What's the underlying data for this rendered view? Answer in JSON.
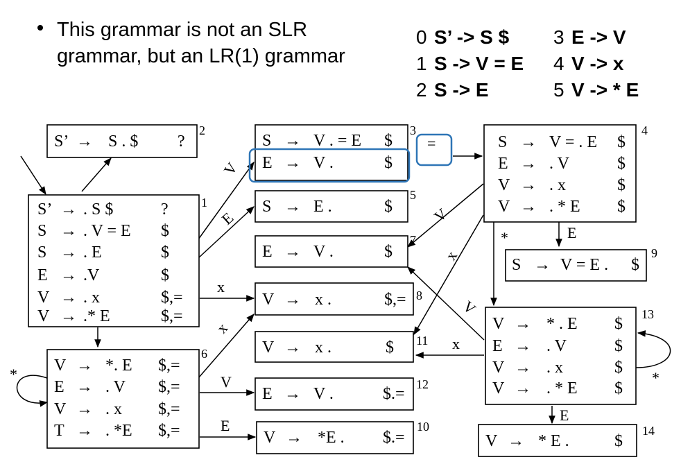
{
  "bullet": {
    "line1": "This grammar is not an SLR",
    "line2": "grammar, but an LR(1) grammar"
  },
  "rules": [
    {
      "num": "0",
      "text": "S’ -> S $"
    },
    {
      "num": "3",
      "text": "E -> V"
    },
    {
      "num": "1",
      "text": "S -> V = E"
    },
    {
      "num": "4",
      "text": "V -> x"
    },
    {
      "num": "2",
      "text": "S -> E"
    },
    {
      "num": "5",
      "text": "V -> * E"
    }
  ],
  "states": {
    "s1": {
      "num": "1",
      "items": [
        {
          "lhs": "S’",
          "rhs": ". S $",
          "la": "?"
        },
        {
          "lhs": "S",
          "rhs": ". V = E",
          "la": "$"
        },
        {
          "lhs": "S",
          "rhs": ". E",
          "la": "$"
        },
        {
          "lhs": "E",
          "rhs": ".V",
          "la": "$"
        },
        {
          "lhs": "V",
          "rhs": ". x",
          "la": "$,="
        },
        {
          "lhs": "V",
          "rhs": ".* E",
          "la": "$,="
        }
      ]
    },
    "s2": {
      "num": "2",
      "items": [
        {
          "lhs": "S’",
          "rhs": "S . $",
          "la": "?"
        }
      ]
    },
    "s3": {
      "num": "3",
      "items": [
        {
          "lhs": "S",
          "rhs": "V . = E",
          "la": "$"
        },
        {
          "lhs": "E",
          "rhs": "V .",
          "la": "$"
        }
      ]
    },
    "s4": {
      "num": "4",
      "items": [
        {
          "lhs": "S",
          "rhs": "V = . E",
          "la": "$"
        },
        {
          "lhs": "E",
          "rhs": ". V",
          "la": "$"
        },
        {
          "lhs": "V",
          "rhs": ". x",
          "la": "$"
        },
        {
          "lhs": "V",
          "rhs": ". * E",
          "la": "$"
        }
      ]
    },
    "s5": {
      "num": "5",
      "items": [
        {
          "lhs": "S",
          "rhs": "E .",
          "la": "$"
        }
      ]
    },
    "s6": {
      "num": "6",
      "items": [
        {
          "lhs": "V",
          "rhs": "*. E",
          "la": "$,="
        },
        {
          "lhs": "E",
          "rhs": ". V",
          "la": "$,="
        },
        {
          "lhs": "V",
          "rhs": ". x",
          "la": "$,="
        },
        {
          "lhs": "T",
          "rhs": ". *E",
          "la": "$,="
        }
      ]
    },
    "s7": {
      "num": "7",
      "items": [
        {
          "lhs": "E",
          "rhs": "V .",
          "la": "$"
        }
      ]
    },
    "s8": {
      "num": "8",
      "items": [
        {
          "lhs": "V",
          "rhs": "x .",
          "la": "$,="
        }
      ]
    },
    "s9": {
      "num": "9",
      "items": [
        {
          "lhs": "S",
          "rhs": "V = E .",
          "la": "$"
        }
      ]
    },
    "s10": {
      "num": "10",
      "items": [
        {
          "lhs": "V",
          "rhs": "*E .",
          "la": "$.="
        }
      ]
    },
    "s11": {
      "num": "11",
      "items": [
        {
          "lhs": "V",
          "rhs": "x .",
          "la": "$"
        }
      ]
    },
    "s12": {
      "num": "12",
      "items": [
        {
          "lhs": "E",
          "rhs": "V .",
          "la": "$.="
        }
      ]
    },
    "s13": {
      "num": "13",
      "items": [
        {
          "lhs": "V",
          "rhs": "* . E",
          "la": "$"
        },
        {
          "lhs": "E",
          "rhs": ". V",
          "la": "$"
        },
        {
          "lhs": "V",
          "rhs": ". x",
          "la": "$"
        },
        {
          "lhs": "V",
          "rhs": ". * E",
          "la": "$"
        }
      ]
    },
    "s14": {
      "num": "14",
      "items": [
        {
          "lhs": "V",
          "rhs": "* E .",
          "la": "$"
        }
      ]
    }
  },
  "edge_labels": {
    "s1_s3": "V",
    "s1_s5": "E",
    "s1_s8": "x",
    "s6_s8": "x",
    "s6_s12": "V",
    "s6_s10": "E",
    "s6_loop": "*",
    "s3_s4": "=",
    "s4_s7": "V",
    "s4_s11": "x",
    "s4_s13": "*",
    "s4_s9": "E",
    "s13_s7": "V",
    "s13_s11": "x",
    "s13_s14": "E",
    "s13_loop": "*"
  },
  "colors": {
    "highlight": "#2e75b6",
    "ink": "#000000"
  }
}
